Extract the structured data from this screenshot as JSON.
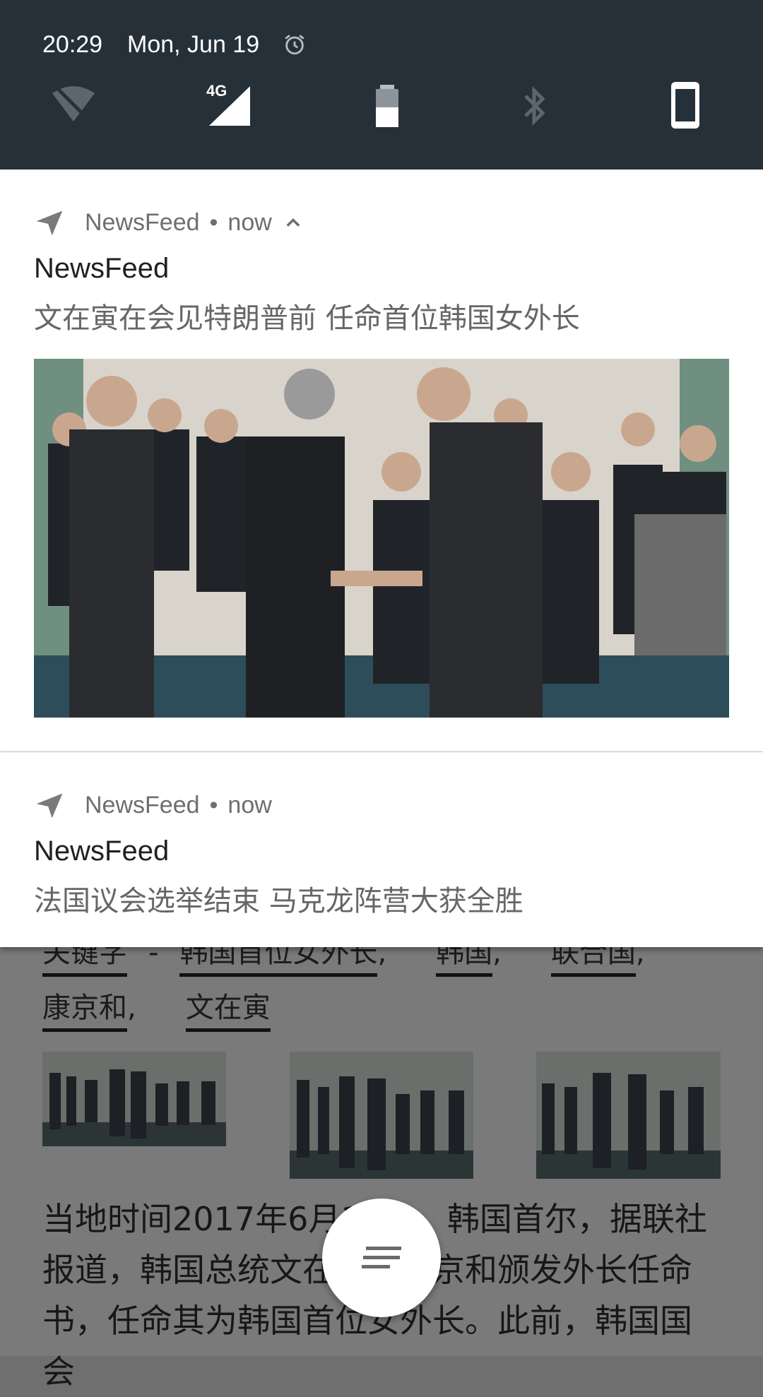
{
  "status_bar": {
    "time": "20:29",
    "date": "Mon, Jun 19",
    "icons": [
      "alarm-icon",
      "wifi-off-icon",
      "signal-4g-icon",
      "battery-icon",
      "bluetooth-off-icon",
      "phone-rotate-icon"
    ],
    "network_label": "4G"
  },
  "notifications": [
    {
      "app": "NewsFeed",
      "separator": "•",
      "time": "now",
      "title": "NewsFeed",
      "text": "文在寅在会见特朗普前 任命首位韩国女外长",
      "expanded": true
    },
    {
      "app": "NewsFeed",
      "separator": "•",
      "time": "now",
      "title": "NewsFeed",
      "text": "法国议会选举结束 马克龙阵营大获全胜",
      "expanded": false
    }
  ],
  "article": {
    "tags_row1": [
      "关键字",
      "韩国首位女外长",
      "韩国",
      "联合国"
    ],
    "tags_row1_separators": [
      " - ",
      ",",
      ",",
      ","
    ],
    "tags_row2": [
      "康京和",
      "文在寅"
    ],
    "tags_row2_separators": [
      ",",
      ""
    ],
    "body": "当地时间2017年6月18日，韩国首尔，据联社报道，韩国总统文在寅向康京和颁发外长任命书，任命其为韩国首位女外长。此前，韩国国会"
  },
  "fab": {
    "icon": "sort-lines-icon"
  },
  "colors": {
    "header_bg": "#263038",
    "notification_bg": "#ffffff",
    "scrim": "#7a7a7a"
  }
}
